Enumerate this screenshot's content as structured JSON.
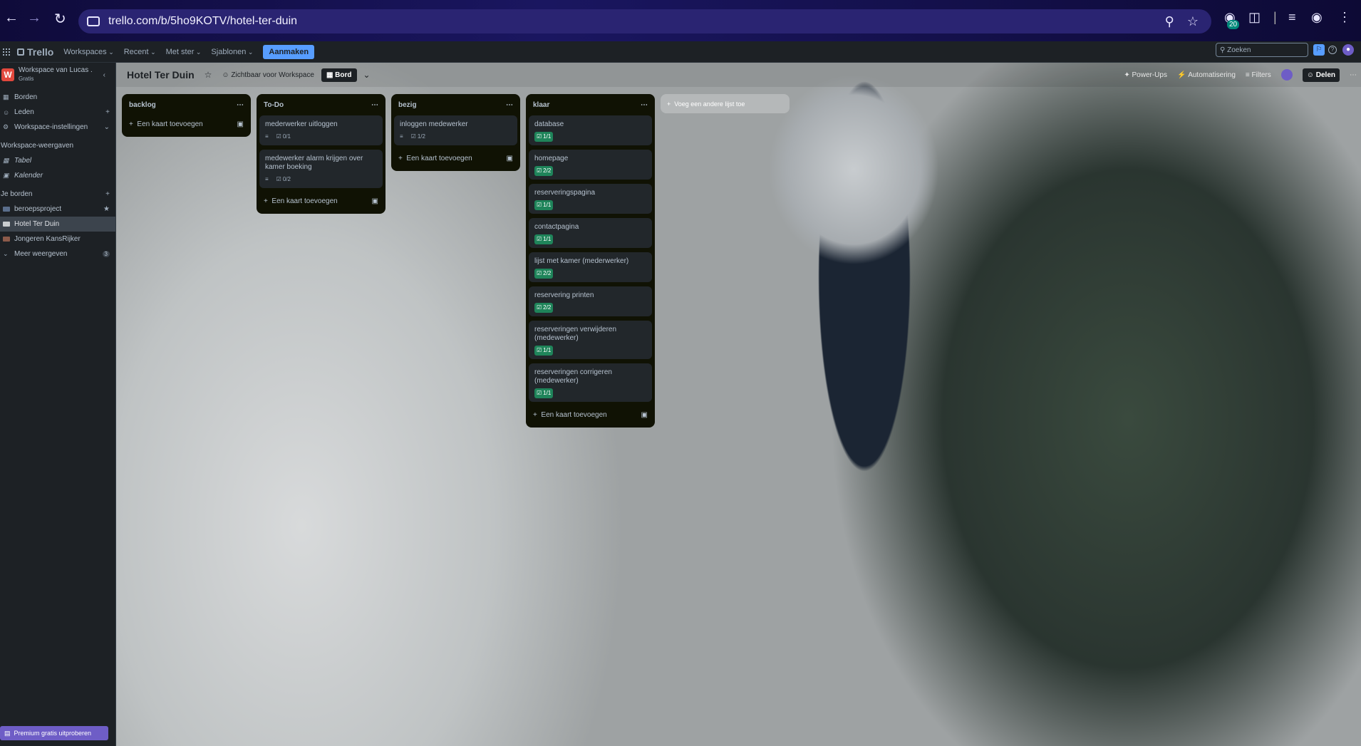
{
  "browser": {
    "url": "trello.com/b/5ho9KOTV/hotel-ter-duin",
    "ext_badge": "20"
  },
  "topbar": {
    "logo": "Trello",
    "menus": [
      "Workspaces",
      "Recent",
      "Met ster",
      "Sjablonen"
    ],
    "create": "Aanmaken",
    "search_placeholder": "Zoeken"
  },
  "sidebar": {
    "workspace_name": "Workspace van Lucas .",
    "workspace_plan": "Gratis",
    "workspace_initial": "W",
    "items": [
      "Borden",
      "Leden",
      "Workspace-instellingen"
    ],
    "views_header": "Workspace-weergaven",
    "views": [
      "Tabel",
      "Kalender"
    ],
    "boards_header": "Je borden",
    "boards": [
      "beroepsproject",
      "Hotel Ter Duin",
      "Jongeren KansRijker"
    ],
    "more": "Meer weergeven",
    "more_count": "3",
    "premium": "Premium gratis uitproberen"
  },
  "board": {
    "title": "Hotel Ter Duin",
    "visibility": "Zichtbaar voor Workspace",
    "view": "Bord",
    "right": {
      "powerups": "Power-Ups",
      "automation": "Automatisering",
      "filters": "Filters",
      "share": "Delen"
    },
    "add_card": "Een kaart toevoegen",
    "add_list": "Voeg een andere lijst toe",
    "lists": [
      {
        "name": "backlog",
        "cards": []
      },
      {
        "name": "To-Do",
        "cards": [
          {
            "title": "mederwerker uitloggen",
            "check": "0/1",
            "done": false
          },
          {
            "title": "medewerker alarm krijgen over kamer boeking",
            "check": "0/2",
            "done": false
          }
        ]
      },
      {
        "name": "bezig",
        "cards": [
          {
            "title": "inloggen medewerker",
            "check": "1/2",
            "done": false
          }
        ]
      },
      {
        "name": "klaar",
        "cards": [
          {
            "title": "database",
            "check": "1/1",
            "done": true
          },
          {
            "title": "homepage",
            "check": "2/2",
            "done": true
          },
          {
            "title": "reserveringspagina",
            "check": "1/1",
            "done": true
          },
          {
            "title": "contactpagina",
            "check": "1/1",
            "done": true
          },
          {
            "title": "lijst met kamer (mederwerker)",
            "check": "2/2",
            "done": true
          },
          {
            "title": "reservering printen",
            "check": "2/2",
            "done": true
          },
          {
            "title": "reserveringen verwijderen (medewerker)",
            "check": "1/1",
            "done": true
          },
          {
            "title": "reserveringen corrigeren (medewerker)",
            "check": "1/1",
            "done": true
          }
        ]
      }
    ]
  }
}
